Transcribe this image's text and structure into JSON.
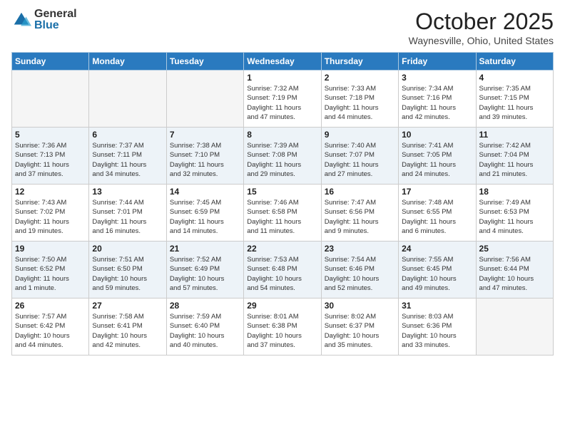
{
  "header": {
    "logo_general": "General",
    "logo_blue": "Blue",
    "month_title": "October 2025",
    "location": "Waynesville, Ohio, United States"
  },
  "days_of_week": [
    "Sunday",
    "Monday",
    "Tuesday",
    "Wednesday",
    "Thursday",
    "Friday",
    "Saturday"
  ],
  "weeks": [
    [
      {
        "num": "",
        "info": ""
      },
      {
        "num": "",
        "info": ""
      },
      {
        "num": "",
        "info": ""
      },
      {
        "num": "1",
        "info": "Sunrise: 7:32 AM\nSunset: 7:19 PM\nDaylight: 11 hours\nand 47 minutes."
      },
      {
        "num": "2",
        "info": "Sunrise: 7:33 AM\nSunset: 7:18 PM\nDaylight: 11 hours\nand 44 minutes."
      },
      {
        "num": "3",
        "info": "Sunrise: 7:34 AM\nSunset: 7:16 PM\nDaylight: 11 hours\nand 42 minutes."
      },
      {
        "num": "4",
        "info": "Sunrise: 7:35 AM\nSunset: 7:15 PM\nDaylight: 11 hours\nand 39 minutes."
      }
    ],
    [
      {
        "num": "5",
        "info": "Sunrise: 7:36 AM\nSunset: 7:13 PM\nDaylight: 11 hours\nand 37 minutes."
      },
      {
        "num": "6",
        "info": "Sunrise: 7:37 AM\nSunset: 7:11 PM\nDaylight: 11 hours\nand 34 minutes."
      },
      {
        "num": "7",
        "info": "Sunrise: 7:38 AM\nSunset: 7:10 PM\nDaylight: 11 hours\nand 32 minutes."
      },
      {
        "num": "8",
        "info": "Sunrise: 7:39 AM\nSunset: 7:08 PM\nDaylight: 11 hours\nand 29 minutes."
      },
      {
        "num": "9",
        "info": "Sunrise: 7:40 AM\nSunset: 7:07 PM\nDaylight: 11 hours\nand 27 minutes."
      },
      {
        "num": "10",
        "info": "Sunrise: 7:41 AM\nSunset: 7:05 PM\nDaylight: 11 hours\nand 24 minutes."
      },
      {
        "num": "11",
        "info": "Sunrise: 7:42 AM\nSunset: 7:04 PM\nDaylight: 11 hours\nand 21 minutes."
      }
    ],
    [
      {
        "num": "12",
        "info": "Sunrise: 7:43 AM\nSunset: 7:02 PM\nDaylight: 11 hours\nand 19 minutes."
      },
      {
        "num": "13",
        "info": "Sunrise: 7:44 AM\nSunset: 7:01 PM\nDaylight: 11 hours\nand 16 minutes."
      },
      {
        "num": "14",
        "info": "Sunrise: 7:45 AM\nSunset: 6:59 PM\nDaylight: 11 hours\nand 14 minutes."
      },
      {
        "num": "15",
        "info": "Sunrise: 7:46 AM\nSunset: 6:58 PM\nDaylight: 11 hours\nand 11 minutes."
      },
      {
        "num": "16",
        "info": "Sunrise: 7:47 AM\nSunset: 6:56 PM\nDaylight: 11 hours\nand 9 minutes."
      },
      {
        "num": "17",
        "info": "Sunrise: 7:48 AM\nSunset: 6:55 PM\nDaylight: 11 hours\nand 6 minutes."
      },
      {
        "num": "18",
        "info": "Sunrise: 7:49 AM\nSunset: 6:53 PM\nDaylight: 11 hours\nand 4 minutes."
      }
    ],
    [
      {
        "num": "19",
        "info": "Sunrise: 7:50 AM\nSunset: 6:52 PM\nDaylight: 11 hours\nand 1 minute."
      },
      {
        "num": "20",
        "info": "Sunrise: 7:51 AM\nSunset: 6:50 PM\nDaylight: 10 hours\nand 59 minutes."
      },
      {
        "num": "21",
        "info": "Sunrise: 7:52 AM\nSunset: 6:49 PM\nDaylight: 10 hours\nand 57 minutes."
      },
      {
        "num": "22",
        "info": "Sunrise: 7:53 AM\nSunset: 6:48 PM\nDaylight: 10 hours\nand 54 minutes."
      },
      {
        "num": "23",
        "info": "Sunrise: 7:54 AM\nSunset: 6:46 PM\nDaylight: 10 hours\nand 52 minutes."
      },
      {
        "num": "24",
        "info": "Sunrise: 7:55 AM\nSunset: 6:45 PM\nDaylight: 10 hours\nand 49 minutes."
      },
      {
        "num": "25",
        "info": "Sunrise: 7:56 AM\nSunset: 6:44 PM\nDaylight: 10 hours\nand 47 minutes."
      }
    ],
    [
      {
        "num": "26",
        "info": "Sunrise: 7:57 AM\nSunset: 6:42 PM\nDaylight: 10 hours\nand 44 minutes."
      },
      {
        "num": "27",
        "info": "Sunrise: 7:58 AM\nSunset: 6:41 PM\nDaylight: 10 hours\nand 42 minutes."
      },
      {
        "num": "28",
        "info": "Sunrise: 7:59 AM\nSunset: 6:40 PM\nDaylight: 10 hours\nand 40 minutes."
      },
      {
        "num": "29",
        "info": "Sunrise: 8:01 AM\nSunset: 6:38 PM\nDaylight: 10 hours\nand 37 minutes."
      },
      {
        "num": "30",
        "info": "Sunrise: 8:02 AM\nSunset: 6:37 PM\nDaylight: 10 hours\nand 35 minutes."
      },
      {
        "num": "31",
        "info": "Sunrise: 8:03 AM\nSunset: 6:36 PM\nDaylight: 10 hours\nand 33 minutes."
      },
      {
        "num": "",
        "info": ""
      }
    ]
  ]
}
